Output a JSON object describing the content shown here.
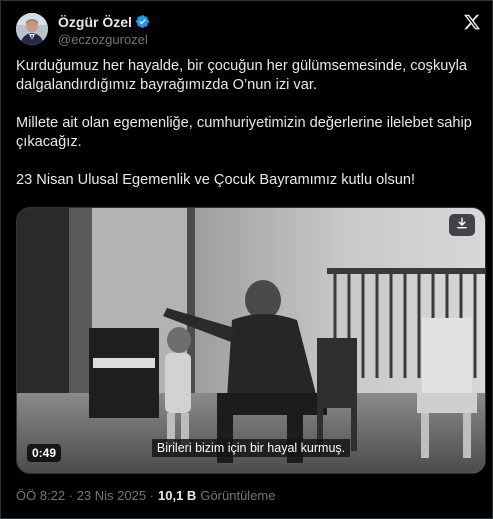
{
  "author": {
    "display_name": "Özgür Özel",
    "handle": "@eczozgurozel",
    "verified": true
  },
  "tweet": {
    "paragraphs": [
      "Kurduğumuz her hayalde, bir çocuğun her gülümsemesinde, coşkuyla dalgalandırdığımız bayrağımızda O’nun izi var.",
      "Millete ait olan egemenliğe, cumhuriyetimizin değerlerine ilelebet sahip çıkacağız.",
      "23 Nisan Ulusal Egemenlik ve Çocuk Bayramımız kutlu olsun!"
    ]
  },
  "media": {
    "duration": "0:49",
    "subtitle": "Birileri bizim için bir hayal kurmuş.",
    "download_icon": "download-icon"
  },
  "meta": {
    "timestamp": "ÖÖ 8:22 · 23 Nis 2025 ·",
    "views_count": "10,1 B",
    "views_label": "Görüntüleme"
  },
  "colors": {
    "background": "#000000",
    "text": "#e7e9ea",
    "secondary_text": "#71767b",
    "verified_badge": "#1d9bf0",
    "border": "#2f3336"
  }
}
